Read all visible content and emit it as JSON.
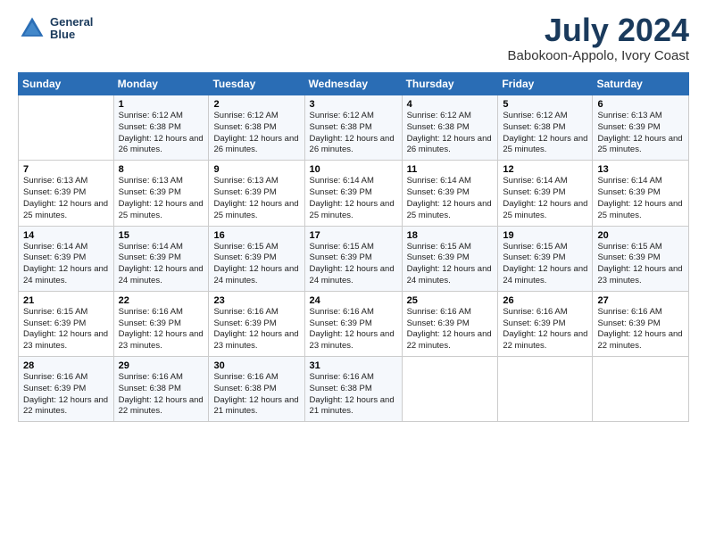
{
  "header": {
    "logo_line1": "General",
    "logo_line2": "Blue",
    "month_year": "July 2024",
    "location": "Babokoon-Appolo, Ivory Coast"
  },
  "days_of_week": [
    "Sunday",
    "Monday",
    "Tuesday",
    "Wednesday",
    "Thursday",
    "Friday",
    "Saturday"
  ],
  "weeks": [
    [
      {
        "num": "",
        "info": ""
      },
      {
        "num": "1",
        "info": "Sunrise: 6:12 AM\nSunset: 6:38 PM\nDaylight: 12 hours\nand 26 minutes."
      },
      {
        "num": "2",
        "info": "Sunrise: 6:12 AM\nSunset: 6:38 PM\nDaylight: 12 hours\nand 26 minutes."
      },
      {
        "num": "3",
        "info": "Sunrise: 6:12 AM\nSunset: 6:38 PM\nDaylight: 12 hours\nand 26 minutes."
      },
      {
        "num": "4",
        "info": "Sunrise: 6:12 AM\nSunset: 6:38 PM\nDaylight: 12 hours\nand 26 minutes."
      },
      {
        "num": "5",
        "info": "Sunrise: 6:12 AM\nSunset: 6:38 PM\nDaylight: 12 hours\nand 25 minutes."
      },
      {
        "num": "6",
        "info": "Sunrise: 6:13 AM\nSunset: 6:39 PM\nDaylight: 12 hours\nand 25 minutes."
      }
    ],
    [
      {
        "num": "7",
        "info": "Sunrise: 6:13 AM\nSunset: 6:39 PM\nDaylight: 12 hours\nand 25 minutes."
      },
      {
        "num": "8",
        "info": "Sunrise: 6:13 AM\nSunset: 6:39 PM\nDaylight: 12 hours\nand 25 minutes."
      },
      {
        "num": "9",
        "info": "Sunrise: 6:13 AM\nSunset: 6:39 PM\nDaylight: 12 hours\nand 25 minutes."
      },
      {
        "num": "10",
        "info": "Sunrise: 6:14 AM\nSunset: 6:39 PM\nDaylight: 12 hours\nand 25 minutes."
      },
      {
        "num": "11",
        "info": "Sunrise: 6:14 AM\nSunset: 6:39 PM\nDaylight: 12 hours\nand 25 minutes."
      },
      {
        "num": "12",
        "info": "Sunrise: 6:14 AM\nSunset: 6:39 PM\nDaylight: 12 hours\nand 25 minutes."
      },
      {
        "num": "13",
        "info": "Sunrise: 6:14 AM\nSunset: 6:39 PM\nDaylight: 12 hours\nand 25 minutes."
      }
    ],
    [
      {
        "num": "14",
        "info": "Sunrise: 6:14 AM\nSunset: 6:39 PM\nDaylight: 12 hours\nand 24 minutes."
      },
      {
        "num": "15",
        "info": "Sunrise: 6:14 AM\nSunset: 6:39 PM\nDaylight: 12 hours\nand 24 minutes."
      },
      {
        "num": "16",
        "info": "Sunrise: 6:15 AM\nSunset: 6:39 PM\nDaylight: 12 hours\nand 24 minutes."
      },
      {
        "num": "17",
        "info": "Sunrise: 6:15 AM\nSunset: 6:39 PM\nDaylight: 12 hours\nand 24 minutes."
      },
      {
        "num": "18",
        "info": "Sunrise: 6:15 AM\nSunset: 6:39 PM\nDaylight: 12 hours\nand 24 minutes."
      },
      {
        "num": "19",
        "info": "Sunrise: 6:15 AM\nSunset: 6:39 PM\nDaylight: 12 hours\nand 24 minutes."
      },
      {
        "num": "20",
        "info": "Sunrise: 6:15 AM\nSunset: 6:39 PM\nDaylight: 12 hours\nand 23 minutes."
      }
    ],
    [
      {
        "num": "21",
        "info": "Sunrise: 6:15 AM\nSunset: 6:39 PM\nDaylight: 12 hours\nand 23 minutes."
      },
      {
        "num": "22",
        "info": "Sunrise: 6:16 AM\nSunset: 6:39 PM\nDaylight: 12 hours\nand 23 minutes."
      },
      {
        "num": "23",
        "info": "Sunrise: 6:16 AM\nSunset: 6:39 PM\nDaylight: 12 hours\nand 23 minutes."
      },
      {
        "num": "24",
        "info": "Sunrise: 6:16 AM\nSunset: 6:39 PM\nDaylight: 12 hours\nand 23 minutes."
      },
      {
        "num": "25",
        "info": "Sunrise: 6:16 AM\nSunset: 6:39 PM\nDaylight: 12 hours\nand 22 minutes."
      },
      {
        "num": "26",
        "info": "Sunrise: 6:16 AM\nSunset: 6:39 PM\nDaylight: 12 hours\nand 22 minutes."
      },
      {
        "num": "27",
        "info": "Sunrise: 6:16 AM\nSunset: 6:39 PM\nDaylight: 12 hours\nand 22 minutes."
      }
    ],
    [
      {
        "num": "28",
        "info": "Sunrise: 6:16 AM\nSunset: 6:39 PM\nDaylight: 12 hours\nand 22 minutes."
      },
      {
        "num": "29",
        "info": "Sunrise: 6:16 AM\nSunset: 6:38 PM\nDaylight: 12 hours\nand 22 minutes."
      },
      {
        "num": "30",
        "info": "Sunrise: 6:16 AM\nSunset: 6:38 PM\nDaylight: 12 hours\nand 21 minutes."
      },
      {
        "num": "31",
        "info": "Sunrise: 6:16 AM\nSunset: 6:38 PM\nDaylight: 12 hours\nand 21 minutes."
      },
      {
        "num": "",
        "info": ""
      },
      {
        "num": "",
        "info": ""
      },
      {
        "num": "",
        "info": ""
      }
    ]
  ]
}
